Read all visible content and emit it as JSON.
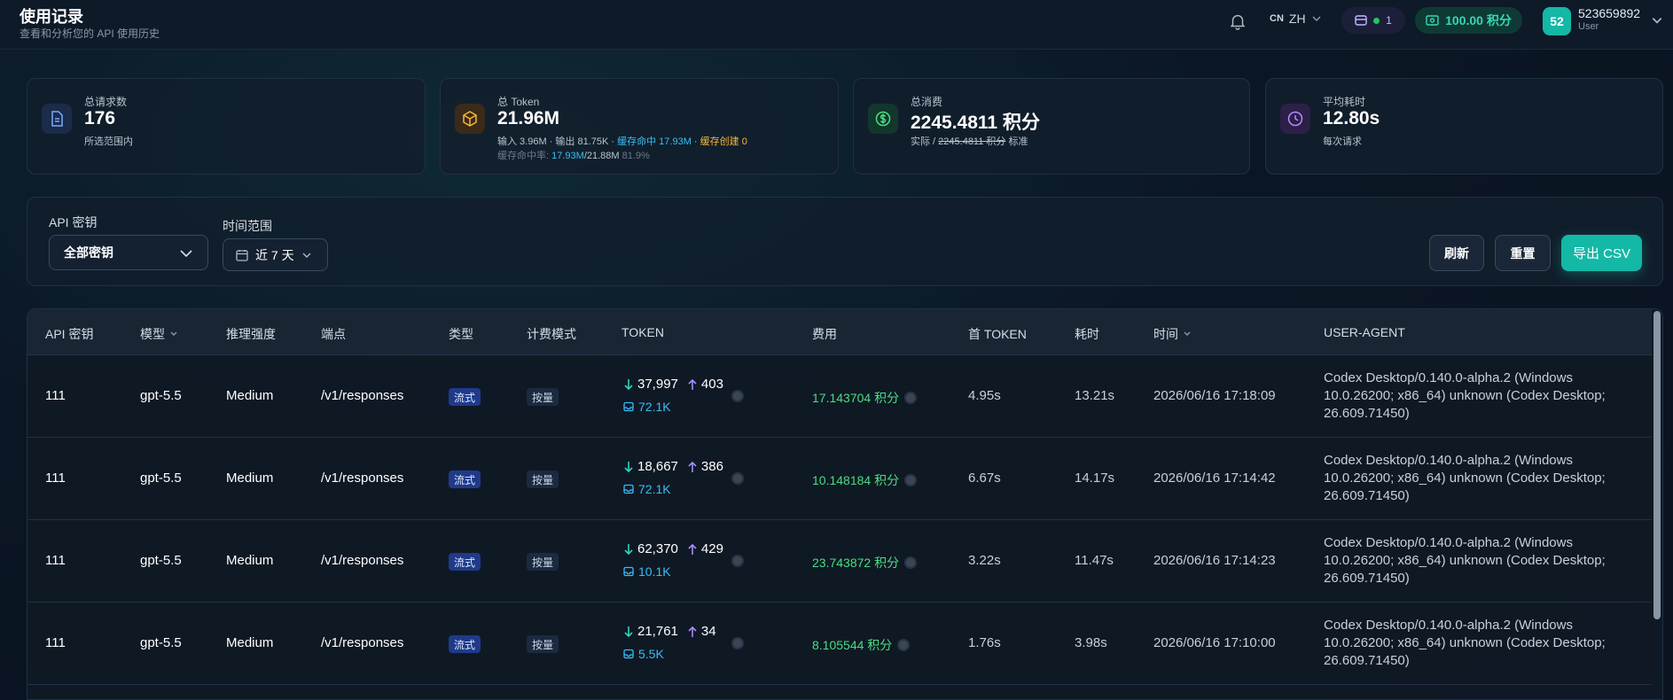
{
  "header": {
    "title": "使用记录",
    "subtitle": "查看和分析您的 API 使用历史",
    "lang_flag": "CN",
    "lang": "ZH",
    "subscription_count": "1",
    "credits": "100.00 积分",
    "avatar": "52",
    "username": "523659892",
    "role": "User"
  },
  "stats": {
    "requests": {
      "label": "总请求数",
      "value": "176",
      "sub": "所选范围内"
    },
    "tokens": {
      "label": "总 Token",
      "value": "21.96M",
      "input": "输入 3.96M · 输出 81.75K · ",
      "cache_hit": "缓存命中 17.93M",
      "sep": " · ",
      "cache_create": "缓存创建 0",
      "hit_rate_label": "缓存命中率: ",
      "hit_rate_hit": "17.93M",
      "hit_rate_total": "/21.88M",
      "hit_rate_pct": " 81.9%"
    },
    "cost": {
      "label": "总消费",
      "value": "2245.4811 积分",
      "sub_prefix": "实际 / ",
      "sub_strike": "2245.4811 积分",
      "sub_suffix": " 标准"
    },
    "latency": {
      "label": "平均耗时",
      "value": "12.80s",
      "sub": "每次请求"
    }
  },
  "filters": {
    "key_label": "API 密钥",
    "key_value": "全部密钥",
    "range_label": "时间范围",
    "range_value": "近 7 天",
    "refresh": "刷新",
    "reset": "重置",
    "export": "导出 CSV"
  },
  "table": {
    "columns": {
      "key": "API 密钥",
      "model": "模型",
      "reasoning": "推理强度",
      "endpoint": "端点",
      "type": "类型",
      "billing": "计费模式",
      "token": "TOKEN",
      "cost": "费用",
      "first_token": "首 TOKEN",
      "duration": "耗时",
      "time": "时间",
      "user_agent": "USER-AGENT"
    },
    "rows": [
      {
        "key": "111",
        "model": "gpt-5.5",
        "reasoning": "Medium",
        "endpoint": "/v1/responses",
        "type": "流式",
        "billing": "按量",
        "input": "37,997",
        "output": "403",
        "cache": "72.1K",
        "cost": "17.143704 积分",
        "first_token": "4.95s",
        "duration": "13.21s",
        "time": "2026/06/16 17:18:09",
        "ua": "Codex Desktop/0.140.0-alpha.2 (Windows 10.0.26200; x86_64) unknown (Codex Desktop; 26.609.71450)"
      },
      {
        "key": "111",
        "model": "gpt-5.5",
        "reasoning": "Medium",
        "endpoint": "/v1/responses",
        "type": "流式",
        "billing": "按量",
        "input": "18,667",
        "output": "386",
        "cache": "72.1K",
        "cost": "10.148184 积分",
        "first_token": "6.67s",
        "duration": "14.17s",
        "time": "2026/06/16 17:14:42",
        "ua": "Codex Desktop/0.140.0-alpha.2 (Windows 10.0.26200; x86_64) unknown (Codex Desktop; 26.609.71450)"
      },
      {
        "key": "111",
        "model": "gpt-5.5",
        "reasoning": "Medium",
        "endpoint": "/v1/responses",
        "type": "流式",
        "billing": "按量",
        "input": "62,370",
        "output": "429",
        "cache": "10.1K",
        "cost": "23.743872 积分",
        "first_token": "3.22s",
        "duration": "11.47s",
        "time": "2026/06/16 17:14:23",
        "ua": "Codex Desktop/0.140.0-alpha.2 (Windows 10.0.26200; x86_64) unknown (Codex Desktop; 26.609.71450)"
      },
      {
        "key": "111",
        "model": "gpt-5.5",
        "reasoning": "Medium",
        "endpoint": "/v1/responses",
        "type": "流式",
        "billing": "按量",
        "input": "21,761",
        "output": "34",
        "cache": "5.5K",
        "cost": "8.105544 积分",
        "first_token": "1.76s",
        "duration": "3.98s",
        "time": "2026/06/16 17:10:00",
        "ua": "Codex Desktop/0.140.0-alpha.2 (Windows 10.0.26200; x86_64) unknown (Codex Desktop; 26.609.71450)"
      }
    ]
  },
  "colors": {
    "accent": "#14b8a6",
    "cost_green": "#4ade80",
    "cache_blue": "#38bdf8",
    "cache_create_amber": "#f5b73b"
  },
  "icons": [
    "bell-icon",
    "chevron-down-icon",
    "card-icon",
    "cash-icon",
    "document-icon",
    "cube-icon",
    "dollar-icon",
    "clock-icon",
    "calendar-icon",
    "arrow-down-icon",
    "arrow-up-icon",
    "database-icon",
    "info-icon"
  ]
}
